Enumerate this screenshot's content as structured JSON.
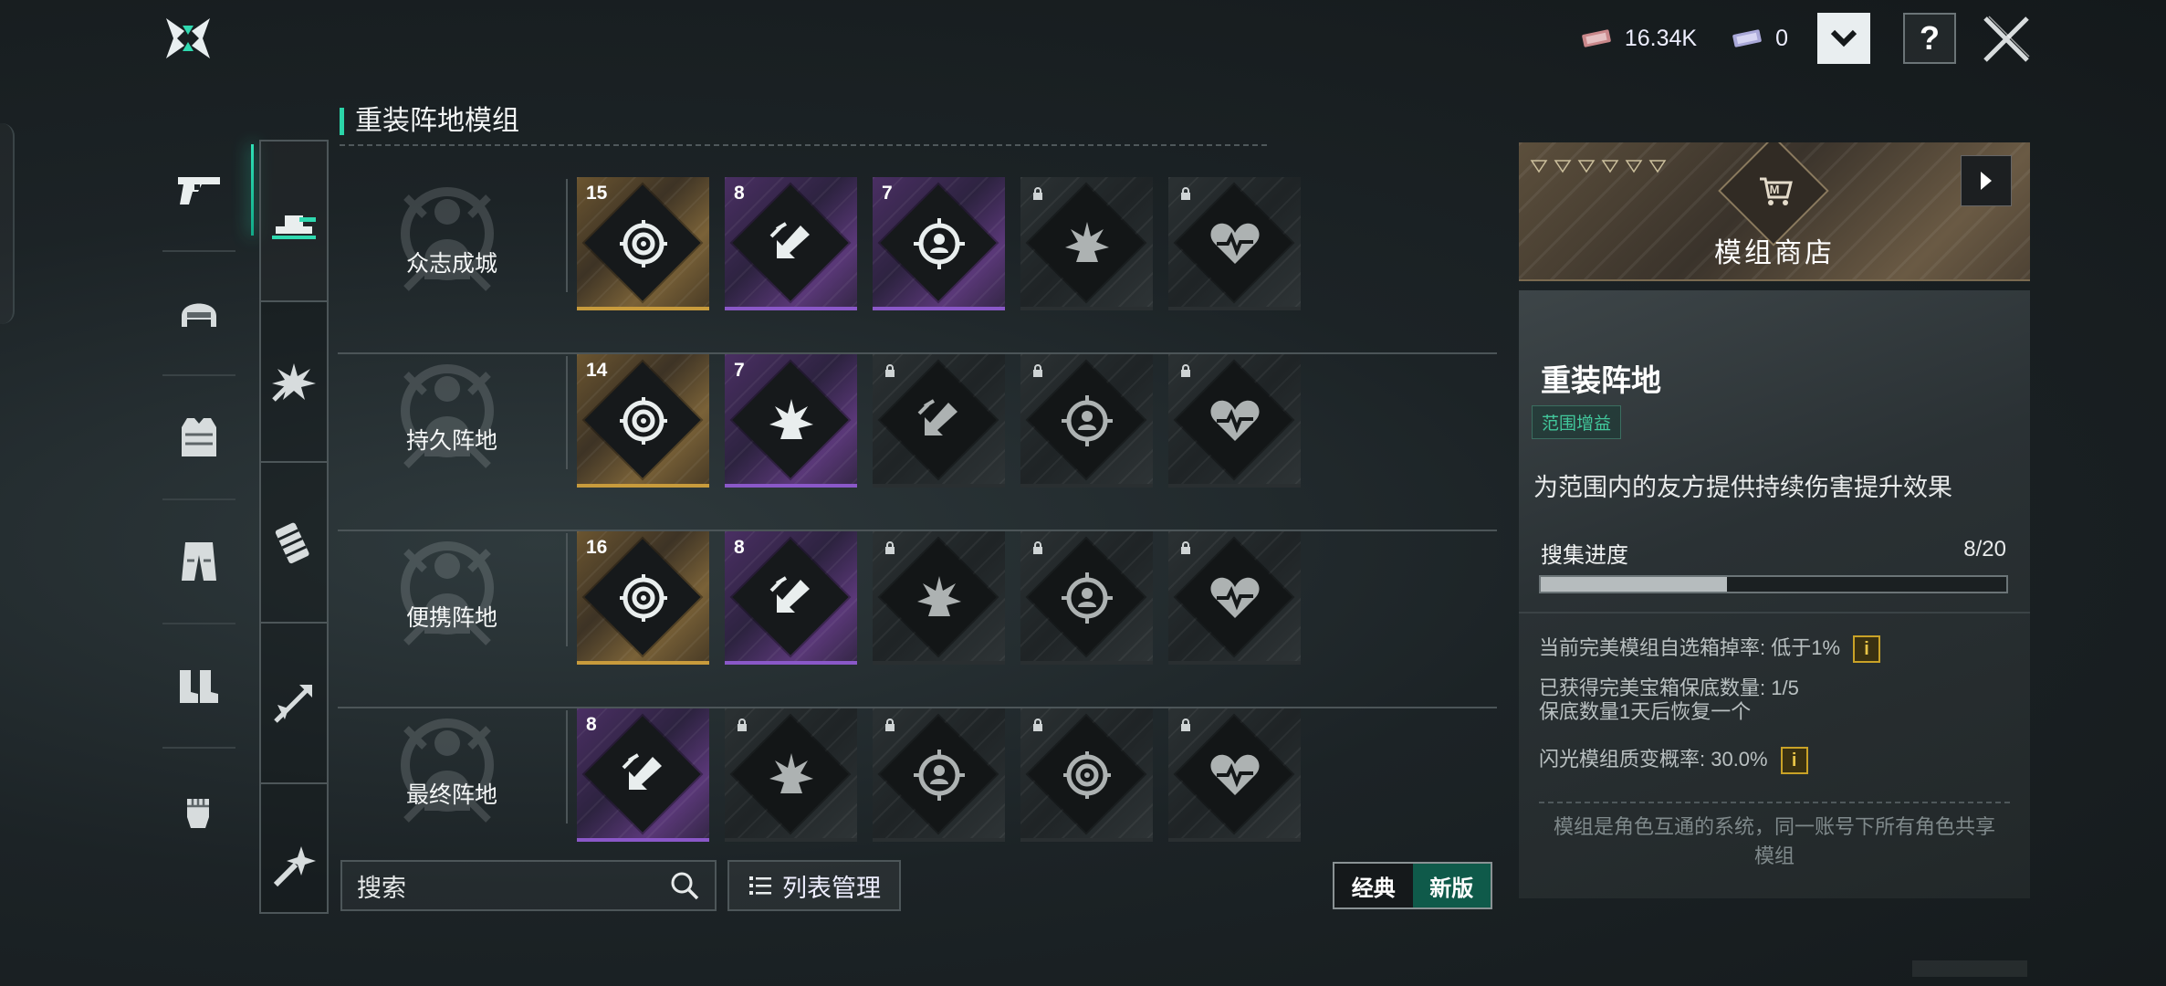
{
  "currencies": [
    {
      "icon": "ticket-icon",
      "value": "16.34K"
    },
    {
      "icon": "card-icon",
      "value": "0"
    }
  ],
  "topbar": {
    "dropdown_icon": "chevron-down-icon",
    "help_label": "?"
  },
  "section": {
    "title": "重装阵地模组"
  },
  "rail": [
    "pistol-icon",
    "helmet-icon",
    "vest-icon",
    "pants-icon",
    "boots-icon",
    "glove-icon"
  ],
  "subtabs": [
    "turret-icon",
    "explosion-icon",
    "ammo-icon",
    "arrow-burst-icon",
    "sparkle-icon"
  ],
  "rows": [
    {
      "label": "众志成城",
      "mods": [
        {
          "rarity": "gold",
          "icon": "target-icon",
          "count": "15"
        },
        {
          "rarity": "purple",
          "icon": "boost-icon",
          "count": "8"
        },
        {
          "rarity": "purple",
          "icon": "crosshair-person-icon",
          "count": "7"
        },
        {
          "rarity": "grey",
          "icon": "explosion-icon",
          "locked": true
        },
        {
          "rarity": "grey",
          "icon": "heart-icon",
          "locked": true
        }
      ]
    },
    {
      "label": "持久阵地",
      "mods": [
        {
          "rarity": "gold",
          "icon": "target-icon",
          "count": "14"
        },
        {
          "rarity": "purple",
          "icon": "explosion-icon",
          "count": "7"
        },
        {
          "rarity": "grey",
          "icon": "boost-icon",
          "locked": true
        },
        {
          "rarity": "grey",
          "icon": "crosshair-person-icon",
          "locked": true
        },
        {
          "rarity": "grey",
          "icon": "heart-icon",
          "locked": true
        }
      ]
    },
    {
      "label": "便携阵地",
      "mods": [
        {
          "rarity": "gold",
          "icon": "target-icon",
          "count": "16"
        },
        {
          "rarity": "purple",
          "icon": "boost-icon",
          "count": "8"
        },
        {
          "rarity": "grey",
          "icon": "explosion-icon",
          "locked": true
        },
        {
          "rarity": "grey",
          "icon": "crosshair-person-icon",
          "locked": true
        },
        {
          "rarity": "grey",
          "icon": "heart-icon",
          "locked": true
        }
      ]
    },
    {
      "label": "最终阵地",
      "mods": [
        {
          "rarity": "purple",
          "icon": "boost-icon",
          "count": "8"
        },
        {
          "rarity": "grey",
          "icon": "explosion-icon",
          "locked": true
        },
        {
          "rarity": "grey",
          "icon": "crosshair-person-icon",
          "locked": true
        },
        {
          "rarity": "grey",
          "icon": "target-icon",
          "locked": true
        },
        {
          "rarity": "grey",
          "icon": "heart-icon",
          "locked": true
        }
      ]
    }
  ],
  "search": {
    "placeholder": "搜索"
  },
  "list_button": {
    "label": "列表管理"
  },
  "version_toggle": {
    "classic": "经典",
    "new": "新版",
    "selected": "新版"
  },
  "shop": {
    "title": "模组商店"
  },
  "detail": {
    "title": "重装阵地",
    "tag": "范围增益",
    "description": "为范围内的友方提供持续伤害提升效果",
    "collect_label": "搜集进度",
    "collect_value": "8/20",
    "collect_progress": 0.4,
    "info1": "当前完美模组自选箱掉率: 低于1%",
    "info2": "已获得完美宝箱保底数量: 1/5",
    "info3": "保底数量1天后恢复一个",
    "info4": "闪光模组质变概率: 30.0%",
    "note": "模组是角色互通的系统，同一账号下所有角色共享模组",
    "info_button": "i"
  }
}
